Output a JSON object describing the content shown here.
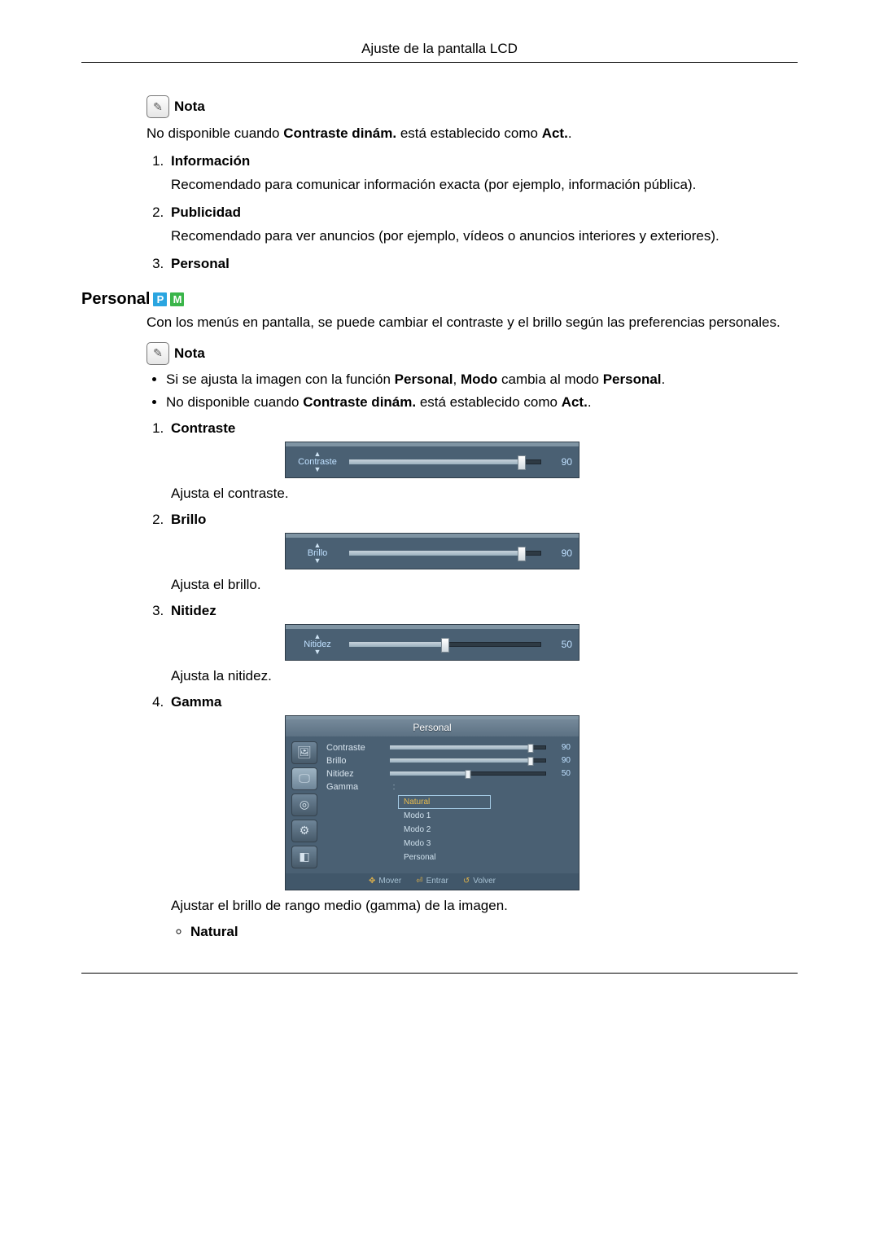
{
  "header": {
    "title": "Ajuste de la pantalla LCD"
  },
  "note1": {
    "label": "Nota",
    "text_pre": "No disponible cuando ",
    "text_bold1": "Contraste dinám.",
    "text_mid": " está establecido como ",
    "text_bold2": "Act.",
    "text_post": "."
  },
  "list1": {
    "items": [
      {
        "title": "Información",
        "desc": "Recomendado para comunicar información exacta (por ejemplo, información pública)."
      },
      {
        "title": "Publicidad",
        "desc": "Recomendado para ver anuncios (por ejemplo, vídeos o anuncios interiores y exteriores)."
      },
      {
        "title": "Personal",
        "desc": ""
      }
    ]
  },
  "section": {
    "heading": "Personal",
    "badges": {
      "p": "P",
      "m": "M"
    },
    "intro": "Con los menús en pantalla, se puede cambiar el contraste y el brillo según las preferencias personales.",
    "note_label": "Nota",
    "bullets": {
      "b1": {
        "pre": "Si se ajusta la imagen con la función ",
        "b1": "Personal",
        "mid1": ", ",
        "b2": "Modo",
        "mid2": " cambia al modo ",
        "b3": "Personal",
        "post": "."
      },
      "b2": {
        "pre": "No disponible cuando ",
        "b1": "Contraste dinám.",
        "mid": " está establecido como ",
        "b2": "Act.",
        "post": "."
      }
    }
  },
  "settings": [
    {
      "title": "Contraste",
      "osd_label": "Contraste",
      "value": "90",
      "pct": 90,
      "desc": "Ajusta el contraste."
    },
    {
      "title": "Brillo",
      "osd_label": "Brillo",
      "value": "90",
      "pct": 90,
      "desc": "Ajusta el brillo."
    },
    {
      "title": "Nitidez",
      "osd_label": "Nitidez",
      "value": "50",
      "pct": 50,
      "desc": "Ajusta la nitidez."
    }
  ],
  "gamma": {
    "title": "Gamma",
    "menu_title": "Personal",
    "rows": [
      {
        "label": "Contraste",
        "val": "90",
        "pct": 90
      },
      {
        "label": "Brillo",
        "val": "90",
        "pct": 90
      },
      {
        "label": "Nitidez",
        "val": "50",
        "pct": 50
      }
    ],
    "gamma_label": "Gamma",
    "options": [
      "Natural",
      "Modo 1",
      "Modo 2",
      "Modo 3",
      "Personal"
    ],
    "active_option": "Natural",
    "footer": {
      "move": "Mover",
      "enter": "Entrar",
      "return": "Volver"
    },
    "desc": "Ajustar el brillo de rango medio (gamma) de la imagen.",
    "sub_bullet": "Natural"
  }
}
